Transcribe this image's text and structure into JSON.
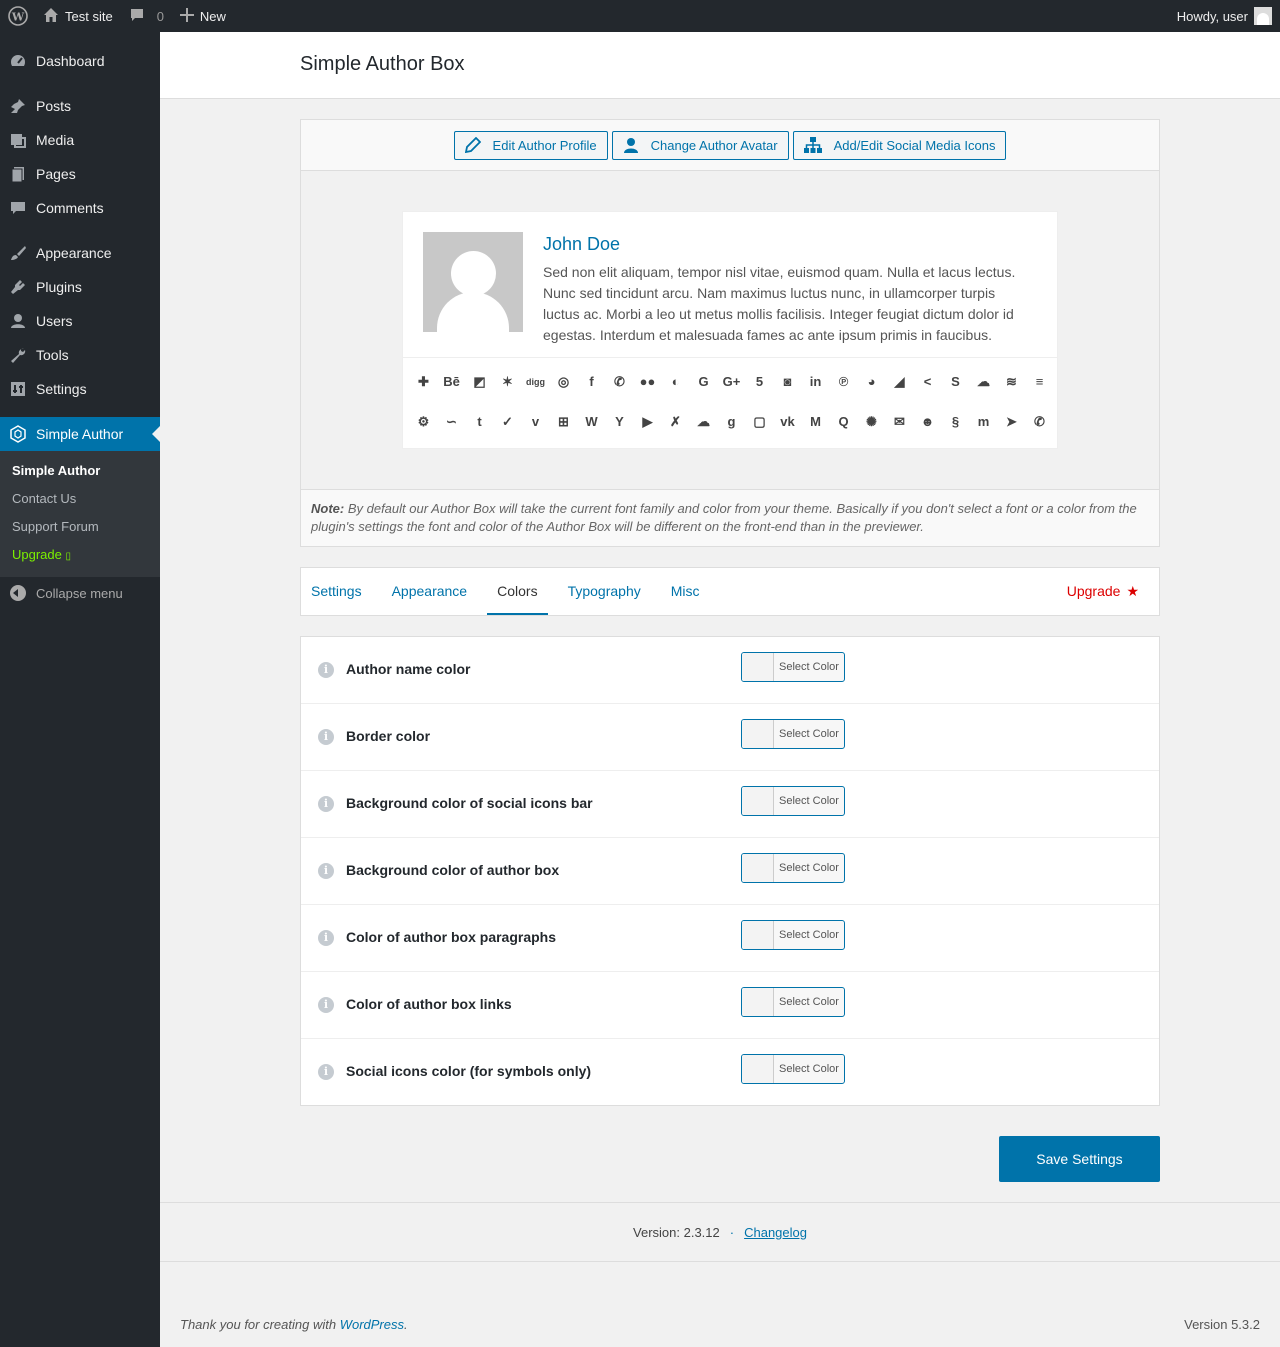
{
  "adminbar": {
    "site": "Test site",
    "comments": "0",
    "new": "New",
    "howdy": "Howdy, user"
  },
  "menu": {
    "items": [
      {
        "label": "Dashboard",
        "icon": "dashboard-icon"
      },
      {
        "label": "Posts",
        "icon": "pin-icon"
      },
      {
        "label": "Media",
        "icon": "media-icon"
      },
      {
        "label": "Pages",
        "icon": "pages-icon"
      },
      {
        "label": "Comments",
        "icon": "comments-icon"
      },
      {
        "label": "Appearance",
        "icon": "brush-icon"
      },
      {
        "label": "Plugins",
        "icon": "plugins-icon"
      },
      {
        "label": "Users",
        "icon": "users-icon"
      },
      {
        "label": "Tools",
        "icon": "wrench-icon"
      },
      {
        "label": "Settings",
        "icon": "settings-icon"
      },
      {
        "label": "Simple Author",
        "icon": "simple-author-icon"
      }
    ],
    "submenu": [
      "Simple Author",
      "Contact Us",
      "Support Forum",
      "Upgrade"
    ],
    "upgrade_arrow": "▯",
    "collapse": "Collapse menu"
  },
  "page": {
    "title": "Simple Author Box"
  },
  "preview": {
    "buttons": [
      "Edit Author Profile",
      "Change Author Avatar",
      "Add/Edit Social Media Icons"
    ],
    "author_name": "John Doe",
    "author_desc": "Sed non elit aliquam, tempor nisl vitae, euismod quam. Nulla et lacus lectus. Nunc sed tincidunt arcu. Nam maximus luctus nunc, in ullamcorper turpis luctus ac. Morbi a leo ut metus mollis facilisis. Integer feugiat dictum dolor id egestas. Interdum et malesuada fames ac ante ipsum primis in faucibus.",
    "social_row1": [
      "✚",
      "Bē",
      "◩",
      "✶",
      "digg",
      "◎",
      "f",
      "✆",
      "●●",
      "◐",
      "G",
      "G+",
      "5",
      "◙",
      "in",
      "℗",
      "◕",
      "◢",
      "<",
      "S",
      "☁",
      "≋",
      "≡"
    ],
    "social_row2": [
      "⚙",
      "∽",
      "t",
      "✓",
      "v",
      "⊞",
      "W",
      "Y",
      "▶",
      "✗",
      "☁",
      "g",
      "▢",
      "vk",
      "M",
      "Q",
      "✺",
      "✉",
      "☻",
      "§",
      "m",
      "➤",
      "✆"
    ],
    "note_label": "Note:",
    "note_text": " By default our Author Box will take the current font family and color from your theme. Basically if you don't select a font or a color from the plugin's settings the font and color of the Author Box will be different on the front-end than in the previewer."
  },
  "tabs": [
    "Settings",
    "Appearance",
    "Colors",
    "Typography",
    "Misc"
  ],
  "active_tab": "Colors",
  "upgrade_tab": "Upgrade",
  "color_settings": [
    "Author name color",
    "Border color",
    "Background color of social icons bar",
    "Background color of author box",
    "Color of author box paragraphs",
    "Color of author box links",
    "Social icons color (for symbols only)"
  ],
  "select_color_label": "Select Color",
  "save_label": "Save Settings",
  "version_footer": {
    "version": "Version: 2.3.12",
    "dot": "·",
    "changelog": "Changelog"
  },
  "wp_footer": {
    "thanks": "Thank you for creating with ",
    "wp_link": "WordPress",
    "period": ".",
    "version": "Version 5.3.2"
  },
  "colors": {
    "accent": "#0073aa",
    "sidebar": "#23282d",
    "upgrade": "#dc0000",
    "upgrade_green": "#7bf000"
  }
}
